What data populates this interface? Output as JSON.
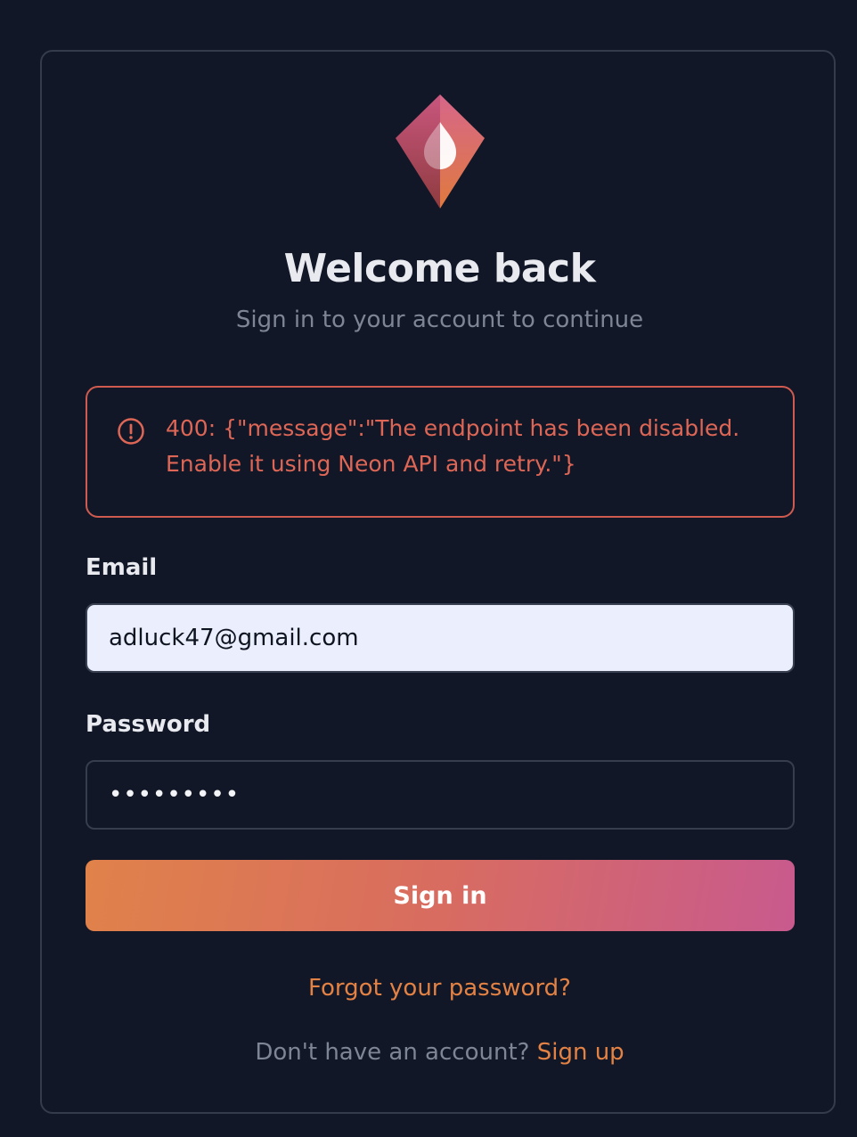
{
  "brand": {
    "logo_icon": "flame-diamond-icon",
    "gradient_top": "#c9567e",
    "gradient_bottom": "#e07a3e"
  },
  "header": {
    "title": "Welcome back",
    "subtitle": "Sign in to your account to continue"
  },
  "error": {
    "icon": "alert-circle-icon",
    "message": "400: {\"message\":\"The endpoint has been disabled. Enable it using Neon API and retry.\"}",
    "color": "#dd6656"
  },
  "form": {
    "email_label": "Email",
    "email_value": "adluck47@gmail.com",
    "password_label": "Password",
    "password_value": "•••••••••",
    "submit_label": "Sign in"
  },
  "footer": {
    "forgot_password": "Forgot your password?",
    "signup_prompt": "Don't have an account?",
    "signup_link": "Sign up"
  },
  "colors": {
    "background": "#111726",
    "accent": "#e38244",
    "button_gradient_start": "#e0824a",
    "button_gradient_end": "#c85a8e"
  }
}
